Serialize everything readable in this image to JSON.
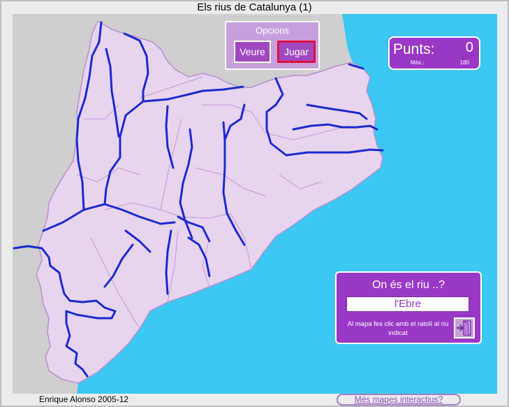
{
  "header": {
    "title": "Els rius de Catalunya (1)"
  },
  "options": {
    "title": "Opcions",
    "view_label": "Veure",
    "play_label": "Jugar"
  },
  "score": {
    "label": "Punts:",
    "value": "0",
    "max_label": "Màx.:",
    "max_value": "180"
  },
  "question": {
    "title": "On és el riu ..?",
    "answer": "l'Ebre",
    "instructions": "Al mapa fes clic amb el ratolí al riu indicat"
  },
  "footer": {
    "author": "Enrique Alonso 2005-12",
    "more_maps": "Més mapes interactius?"
  },
  "colors": {
    "sea": "#3cc8f2",
    "land": "#e7d4ee",
    "border": "#b98fcf",
    "river": "#1a2ad0",
    "panel": "#9a38c6",
    "outside": "#cfcfcf"
  },
  "icons": {
    "exit": "exit-door-icon"
  }
}
